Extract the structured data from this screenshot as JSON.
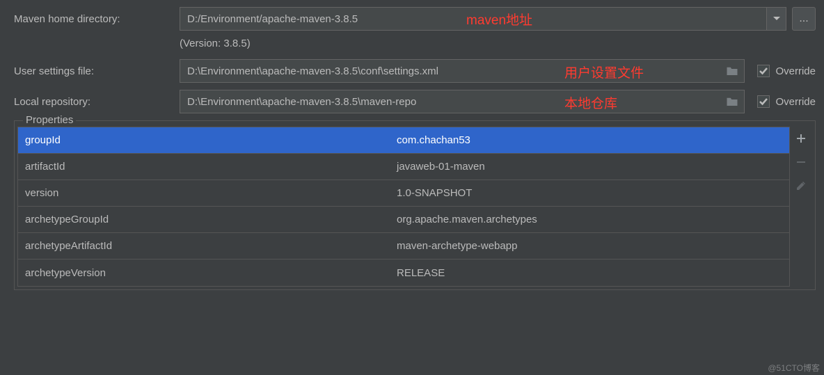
{
  "labels": {
    "maven_home": "Maven home directory:",
    "user_settings": "User settings file:",
    "local_repo": "Local repository:",
    "override": "Override",
    "properties": "Properties",
    "version_prefix": "(Version: 3.8.5)"
  },
  "values": {
    "maven_home": "D:/Environment/apache-maven-3.8.5",
    "user_settings": "D:\\Environment\\apache-maven-3.8.5\\conf\\settings.xml",
    "local_repo": "D:\\Environment\\apache-maven-3.8.5\\maven-repo"
  },
  "overrides": {
    "user_settings": true,
    "local_repo": true
  },
  "annotations": {
    "maven_addr": "maven地址",
    "user_settings_file": "用户设置文件",
    "local_repo": "本地仓库"
  },
  "properties": [
    {
      "key": "groupId",
      "value": "com.chachan53"
    },
    {
      "key": "artifactId",
      "value": "javaweb-01-maven"
    },
    {
      "key": "version",
      "value": "1.0-SNAPSHOT"
    },
    {
      "key": "archetypeGroupId",
      "value": "org.apache.maven.archetypes"
    },
    {
      "key": "archetypeArtifactId",
      "value": "maven-archetype-webapp"
    },
    {
      "key": "archetypeVersion",
      "value": "RELEASE"
    }
  ],
  "watermark": "@51CTO博客",
  "more_btn": "..."
}
